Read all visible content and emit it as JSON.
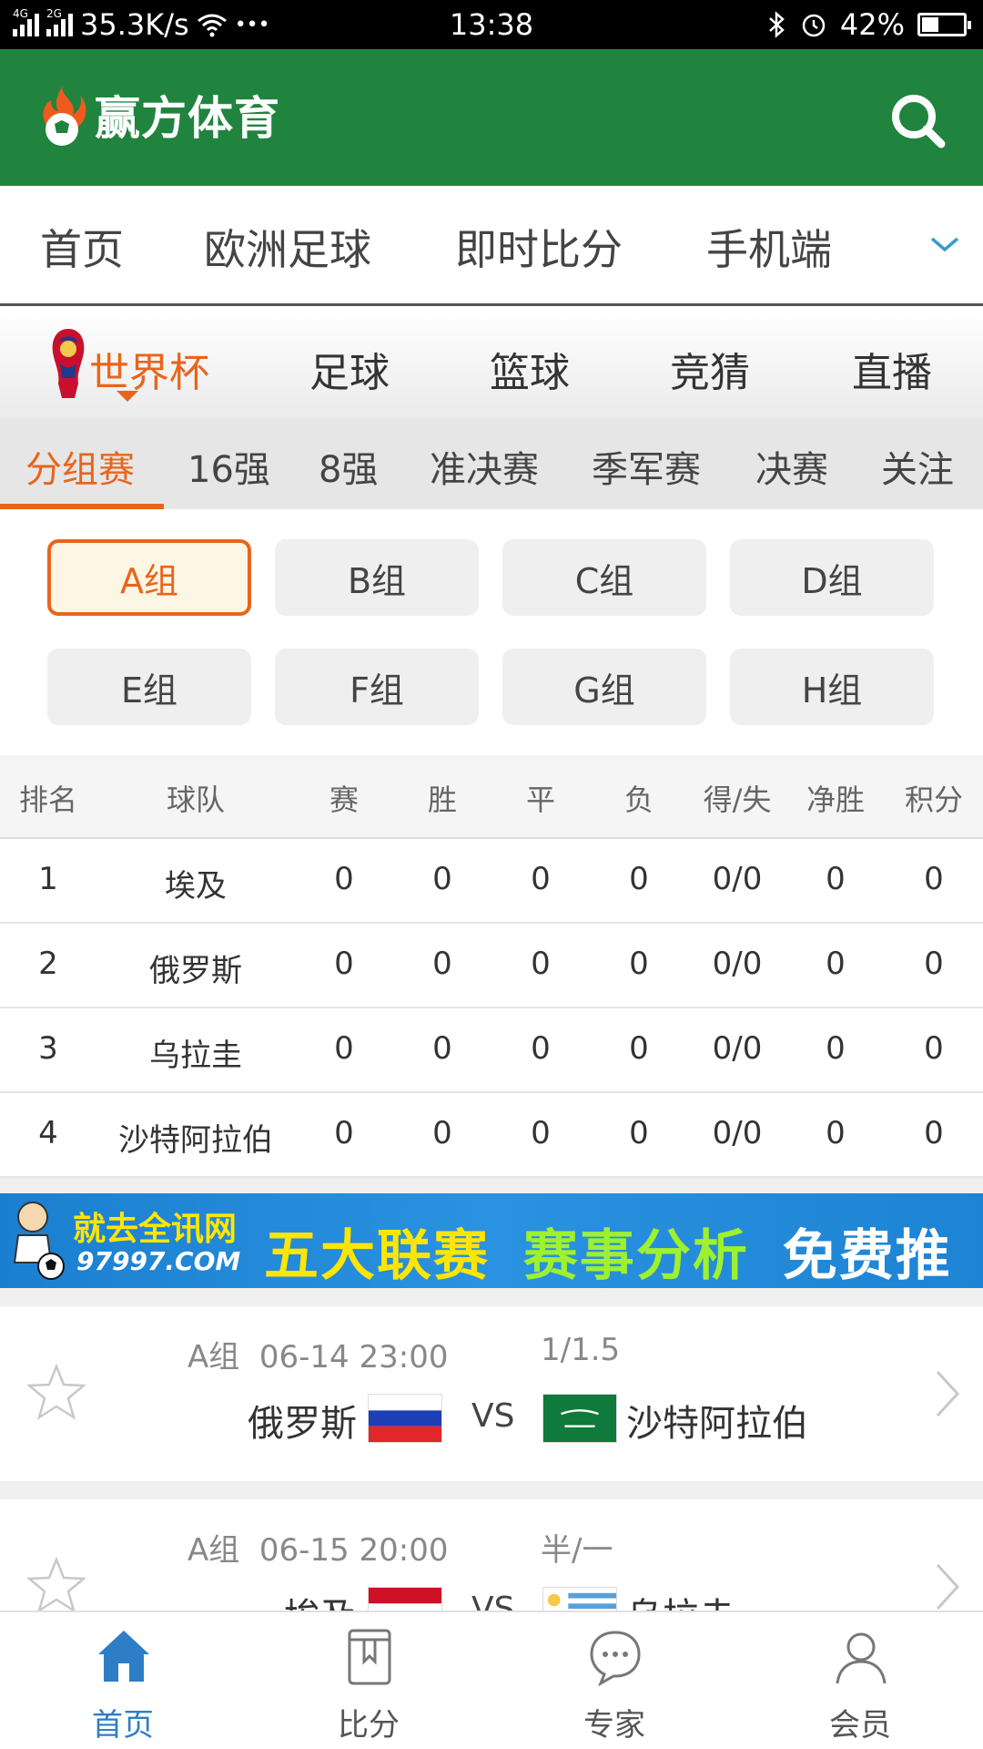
{
  "status_bar": {
    "net1": "4G",
    "net2": "2G",
    "speed": "35.3K/s",
    "dots": "•••",
    "time": "13:38",
    "battery": "42%",
    "battery_level": 0.42
  },
  "header": {
    "title": "赢方体育",
    "brand_color": "#20843e"
  },
  "nav": {
    "items": [
      "首页",
      "欧洲足球",
      "即时比分",
      "手机端"
    ]
  },
  "sport_tabs": {
    "items": [
      "世界杯",
      "足球",
      "篮球",
      "竞猜",
      "直播"
    ],
    "active_index": 0,
    "accent": "#e8651c"
  },
  "stage_tabs": {
    "items": [
      "分组赛",
      "16强",
      "8强",
      "准决赛",
      "季军赛",
      "决赛",
      "关注"
    ],
    "active_index": 0
  },
  "groups": {
    "items": [
      "A组",
      "B组",
      "C组",
      "D组",
      "E组",
      "F组",
      "G组",
      "H组"
    ],
    "active": "A组"
  },
  "standings": {
    "columns": [
      "排名",
      "球队",
      "赛",
      "胜",
      "平",
      "负",
      "得/失",
      "净胜",
      "积分"
    ],
    "rows": [
      [
        "1",
        "埃及",
        "0",
        "0",
        "0",
        "0",
        "0/0",
        "0",
        "0"
      ],
      [
        "2",
        "俄罗斯",
        "0",
        "0",
        "0",
        "0",
        "0/0",
        "0",
        "0"
      ],
      [
        "3",
        "乌拉圭",
        "0",
        "0",
        "0",
        "0",
        "0/0",
        "0",
        "0"
      ],
      [
        "4",
        "沙特阿拉伯",
        "0",
        "0",
        "0",
        "0",
        "0/0",
        "0",
        "0"
      ]
    ]
  },
  "banner": {
    "brand": "就去全讯网",
    "url": "97997.COM",
    "seg1": "五大联赛",
    "seg2": "赛事分析",
    "seg3": "免费推荐"
  },
  "matches": [
    {
      "group": "A组",
      "datetime": "06-14 23:00",
      "odds": "1/1.5",
      "home": "俄罗斯",
      "vs": "VS",
      "away": "沙特阿拉伯"
    },
    {
      "group": "A组",
      "datetime": "06-15 20:00",
      "odds": "半/一",
      "home": "埃及",
      "vs": "VS",
      "away": "乌拉圭"
    }
  ],
  "bottom_bar": {
    "items": [
      "首页",
      "比分",
      "专家",
      "会员"
    ],
    "active_index": 0,
    "active_color": "#2d7ec6"
  }
}
